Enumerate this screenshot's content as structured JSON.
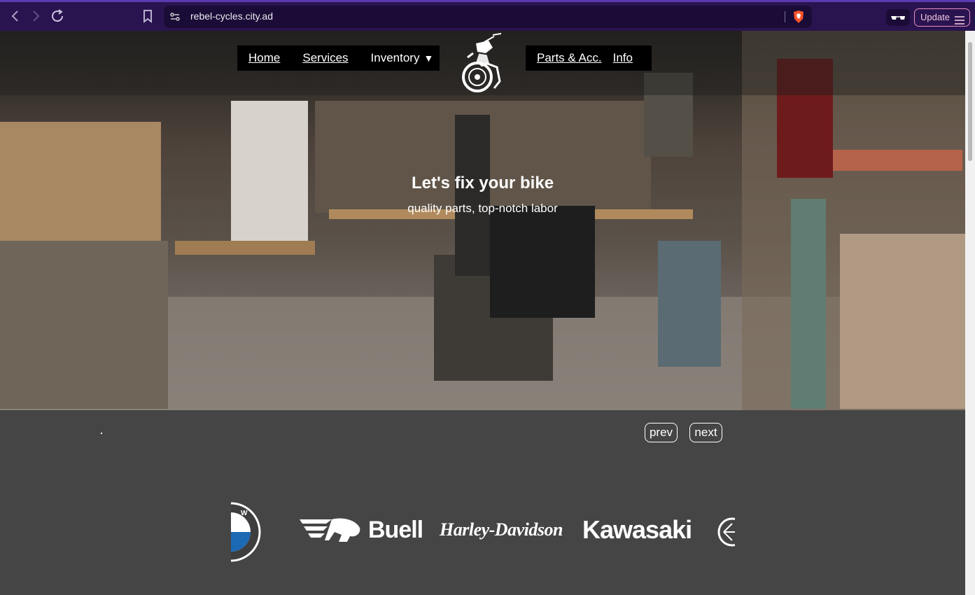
{
  "browser": {
    "url": "rebel-cycles.city.ad",
    "update_label": "Update",
    "icons": [
      "back-icon",
      "forward-icon",
      "reload-icon",
      "bookmark-icon",
      "site-settings-icon",
      "brave-shield-icon",
      "reader-glasses-icon",
      "menu-icon"
    ]
  },
  "nav": {
    "left": [
      "Home",
      "Services",
      "Inventory"
    ],
    "inventory_caret": "▼",
    "right": [
      "Parts & Acc.",
      "Info"
    ]
  },
  "hero": {
    "title": "Let's fix your bike",
    "subtitle": "quality parts, top-notch labor"
  },
  "slider": {
    "prev_label": "prev",
    "next_label": "next"
  },
  "brands": {
    "buell": "Buell",
    "harley": "Harley-Davidson",
    "kawasaki": "Kawasaki"
  },
  "colors": {
    "chrome_bg": "#2a1450",
    "page_bg": "#454545",
    "update_border": "#e58ec0"
  }
}
